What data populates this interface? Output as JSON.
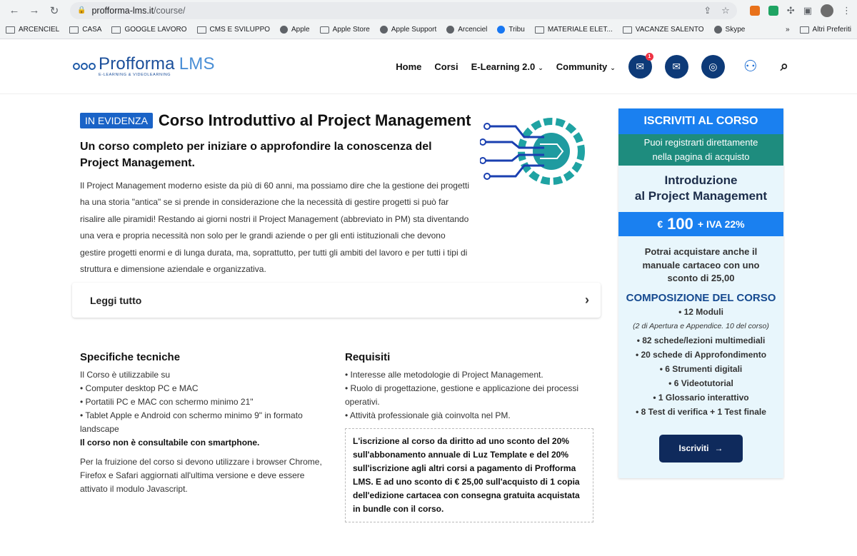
{
  "browser": {
    "url_domain": "profforma-lms.it",
    "url_path": "/course/",
    "bookmarks": [
      "ARCENCIEL",
      "CASA",
      "GOOGLE LAVORO",
      "CMS E SVILUPPO",
      "Apple",
      "Apple Store",
      "Apple Support",
      "Arcenciel",
      "Tribu",
      "MATERIALE ELET...",
      "VACANZE SALENTO",
      "Skype"
    ],
    "bookmarks_more": "»",
    "other_bookmarks": "Altri Preferiti"
  },
  "site": {
    "logo_main": "Profforma",
    "logo_lms": "LMS",
    "logo_sub": "E-LEARNING & VIDEOLEARNING",
    "nav": {
      "home": "Home",
      "corsi": "Corsi",
      "elearning": "E-Learning 2.0",
      "community": "Community"
    },
    "notification_count": "1"
  },
  "course": {
    "badge": "IN EVIDENZA",
    "title": "Corso Introduttivo al Project Management",
    "subtitle": "Un corso completo per iniziare o approfondire la conoscenza del Project Management.",
    "description": "Il Project Management moderno esiste da più di 60 anni, ma possiamo dire che la gestione dei progetti ha una storia \"antica\" se si prende in considerazione che la necessità di gestire progetti si può far risalire alle piramidi! Restando ai giorni nostri il Project Management (abbreviato in PM) sta diventando una vera e propria necessità non solo per le grandi aziende o per gli enti istituzionali che devono gestire progetti enormi e di lunga durata, ma, soprattutto, per tutti gli ambiti del lavoro e per tutti i tipi di struttura e dimensione aziendale e organizzativa.",
    "read_more": "Leggi tutto"
  },
  "specs": {
    "title": "Specifiche tecniche",
    "intro": "Il Corso è utilizzabile su",
    "items": [
      "• Computer desktop PC e MAC",
      "• Portatili PC e MAC con schermo minimo 21\"",
      "• Tablet Apple e Android con schermo minimo 9\" in formato landscape"
    ],
    "warning": "Il corso non è consultabile con smartphone.",
    "browsers": "Per la fruizione del corso si devono utilizzare i browser Chrome, Firefox e Safari aggiornati all'ultima versione e deve essere attivato il modulo Javascript."
  },
  "requirements": {
    "title": "Requisiti",
    "items": [
      "• Interesse alle metodologie di Project Management.",
      "• Ruolo di progettazione, gestione e applicazione dei processi operativi.",
      "• Attività professionale già coinvolta nel PM."
    ],
    "box": "L'iscrizione al corso da diritto ad uno sconto del 20% sull'abbonamento annuale di Luz Template e del 20% sull'iscrizione agli altri corsi a pagamento di Profforma LMS. E ad uno sconto di € 25,00 sull'acquisto di 1 copia dell'edizione cartacea con consegna gratuita acquistata in bundle con il corso."
  },
  "sidebar": {
    "header": "ISCRIVITI AL CORSO",
    "note": "Puoi registrarti direttamente nella pagina di acquisto",
    "course_line1": "Introduzione",
    "course_line2": "al Project Management",
    "currency": "€",
    "price": "100",
    "vat": "+ IVA 22%",
    "manual": "Potrai acquistare anche il manuale cartaceo con uno sconto di 25,00",
    "composition_title": "COMPOSIZIONE DEL CORSO",
    "modules": "• 12 Moduli",
    "modules_note": "(2 di Apertura e Appendice. 10 del corso)",
    "items": [
      "• 82 schede/lezioni multimediali",
      "• 20 schede di Approfondimento",
      "• 6 Strumenti digitali",
      "• 6 Videotutorial",
      "• 1 Glossario interattivo",
      "• 8 Test di verifica + 1 Test finale"
    ],
    "cta": "Iscriviti"
  }
}
